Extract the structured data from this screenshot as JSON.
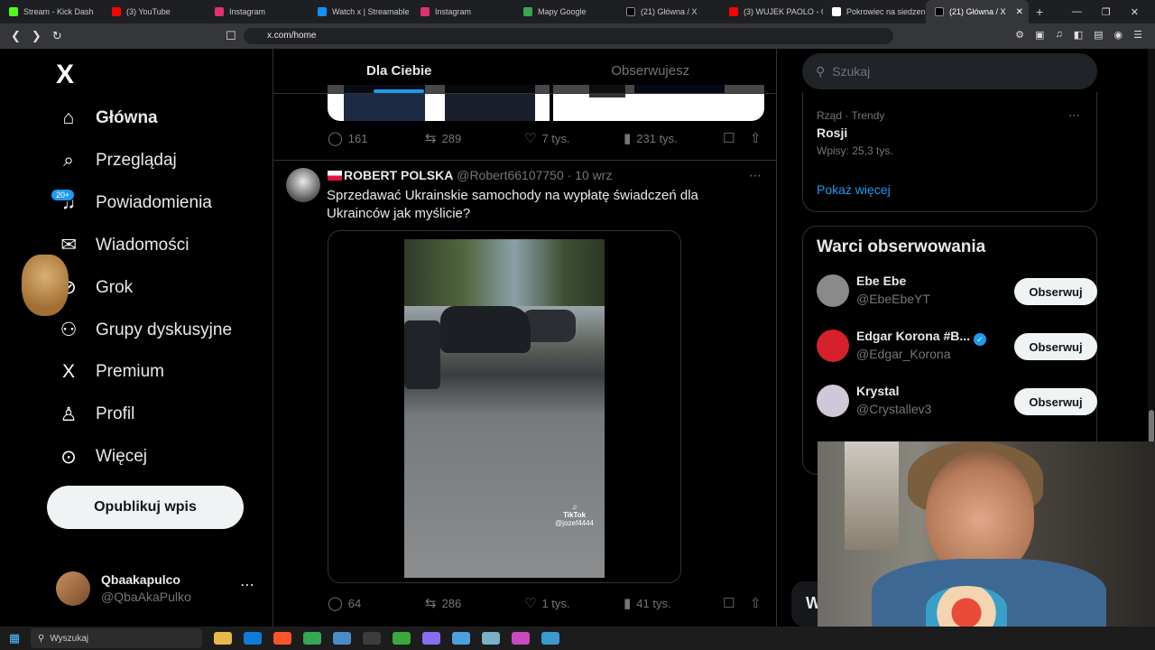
{
  "browser": {
    "tabs": [
      {
        "label": "Stream - Kick Dash",
        "color": "#53fc18"
      },
      {
        "label": "(3) YouTube",
        "color": "#ff0000"
      },
      {
        "label": "Instagram",
        "color": "#e1306c"
      },
      {
        "label": "Watch x | Streamable",
        "color": "#0f90fa"
      },
      {
        "label": "Instagram",
        "color": "#e1306c"
      },
      {
        "label": "Mapy Google",
        "color": "#34a853"
      },
      {
        "label": "(21) Główna / X",
        "color": "#000000"
      },
      {
        "label": "(3) WUJEK PAOLO - OF",
        "color": "#ff0000"
      },
      {
        "label": "Pokrowiec na siedzeni",
        "color": "#ffffff"
      },
      {
        "label": "(21) Główna / X",
        "color": "#000000",
        "active": true
      }
    ],
    "url": "x.com/home"
  },
  "nav": {
    "items": [
      {
        "label": "Główna",
        "icon": "home-icon",
        "glyph": "⌂"
      },
      {
        "label": "Przeglądaj",
        "icon": "search-icon",
        "glyph": "⌕"
      },
      {
        "label": "Powiadomienia",
        "icon": "bell-icon",
        "glyph": "♫",
        "badge": "20+"
      },
      {
        "label": "Wiadomości",
        "icon": "mail-icon",
        "glyph": "✉"
      },
      {
        "label": "Grok",
        "icon": "grok-icon",
        "glyph": "⊘"
      },
      {
        "label": "Grupy dyskusyjne",
        "icon": "communities-icon",
        "glyph": "⚇"
      },
      {
        "label": "Premium",
        "icon": "x-premium-icon",
        "glyph": "X"
      },
      {
        "label": "Profil",
        "icon": "person-icon",
        "glyph": "♙"
      },
      {
        "label": "Więcej",
        "icon": "more-circle-icon",
        "glyph": "⊙"
      }
    ],
    "post_button": "Opublikuj wpis",
    "account": {
      "name": "Qbaakapulco",
      "handle": "@QbaAkaPulko"
    }
  },
  "feed": {
    "tabs": [
      "Dla Ciebie",
      "Obserwujesz"
    ],
    "prev_post_stats": {
      "replies": "161",
      "reposts": "289",
      "likes": "7 tys.",
      "views": "231 tys."
    },
    "tweet": {
      "name": "ROBERT POLSKA",
      "handle": "@Robert66107750",
      "time": "· 10 wrz",
      "text": "Sprzedawać Ukrainskie samochody na wypłatę świadczeń dla Ukrainców jak myślicie?",
      "video_watermark": "TikTok",
      "video_user": "@jozef4444",
      "stats": {
        "replies": "64",
        "reposts": "286",
        "likes": "1 tys.",
        "views": "41 tys."
      }
    }
  },
  "sidebar": {
    "search_placeholder": "Szukaj",
    "trend": {
      "context": "Rząd · Trendy",
      "name": "Rosji",
      "count": "Wpisy: 25,3 tys.",
      "show_more": "Pokaż więcej"
    },
    "who_to_follow": {
      "title": "Warci obserwowania",
      "users": [
        {
          "name": "Ebe Ebe",
          "handle": "@EbeEbeYT",
          "button": "Obserwuj",
          "avatar_color": "#8a8a8a"
        },
        {
          "name": "Edgar Korona #B...",
          "handle": "@Edgar_Korona",
          "button": "Obserwuj",
          "verified": true,
          "avatar_color": "#d4202a"
        },
        {
          "name": "Krystal",
          "handle": "@Crystallev3",
          "button": "Obserwuj",
          "avatar_color": "#cfc8d8"
        }
      ]
    },
    "partial_button": "W"
  },
  "taskbar": {
    "search": "Wyszukaj",
    "apps": [
      "#e8b84a",
      "#0f7bd8",
      "#fb542b",
      "#34a853",
      "#4a8cc8",
      "#3c3c3c",
      "#3aa83a",
      "#8a6cf0",
      "#4aa0e0",
      "#7ab0c8",
      "#c84ac0",
      "#3a9ad0"
    ]
  }
}
